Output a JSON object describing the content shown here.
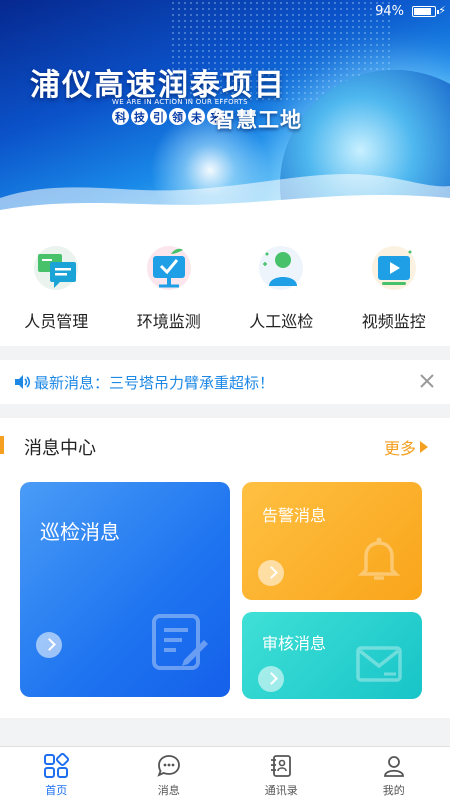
{
  "status": {
    "battery": "94%"
  },
  "banner": {
    "title": "浦仪高速润泰项目",
    "slogan_small": "WE ARE IN ACTION IN OUR EFFORTS",
    "tags": [
      "科",
      "技",
      "引",
      "领",
      "未",
      "来"
    ],
    "subtitle": "智慧工地"
  },
  "quick": [
    {
      "label": "人员管理",
      "icon": "chat-people-icon"
    },
    {
      "label": "环境监测",
      "icon": "plant-check-icon"
    },
    {
      "label": "人工巡检",
      "icon": "person-icon"
    },
    {
      "label": "视频监控",
      "icon": "video-play-icon"
    }
  ],
  "notice": {
    "text": "最新消息：三号塔吊力臂承重超标！"
  },
  "messages": {
    "title": "消息中心",
    "more": "更多",
    "cards": {
      "inspection": "巡检消息",
      "warning": "告警消息",
      "audit": "审核消息"
    }
  },
  "tabs": [
    {
      "label": "首页",
      "icon": "home-grid-icon",
      "active": true
    },
    {
      "label": "消息",
      "icon": "message-bubble-icon",
      "active": false
    },
    {
      "label": "通讯录",
      "icon": "contacts-icon",
      "active": false
    },
    {
      "label": "我的",
      "icon": "user-icon",
      "active": false
    }
  ],
  "colors": {
    "accent": "#1e6ff0",
    "orange": "#f5a020",
    "notice": "#1e88e5"
  }
}
